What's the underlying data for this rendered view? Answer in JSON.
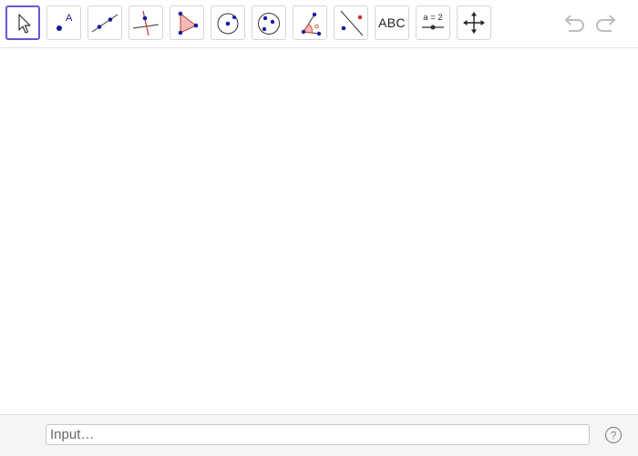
{
  "toolbar": {
    "tools": [
      {
        "id": "move",
        "icon": "move-pointer-icon",
        "selected": true
      },
      {
        "id": "point",
        "icon": "point-icon",
        "label_text": "A"
      },
      {
        "id": "line",
        "icon": "line-through-two-points-icon"
      },
      {
        "id": "perpendicular",
        "icon": "perpendicular-line-icon"
      },
      {
        "id": "polygon",
        "icon": "polygon-icon"
      },
      {
        "id": "circle-center-point",
        "icon": "circle-center-point-icon"
      },
      {
        "id": "circle-three-points",
        "icon": "circle-three-points-icon"
      },
      {
        "id": "angle",
        "icon": "angle-icon"
      },
      {
        "id": "reflect",
        "icon": "reflect-about-line-icon"
      },
      {
        "id": "text",
        "icon": "text-icon",
        "label_text": "ABC"
      },
      {
        "id": "slider",
        "icon": "slider-icon",
        "label_text": "a = 2"
      },
      {
        "id": "move-graphics-view",
        "icon": "move-graphics-view-icon"
      }
    ],
    "undo_icon": "undo-icon",
    "redo_icon": "redo-icon"
  },
  "input_bar": {
    "placeholder": "Input…",
    "help_icon": "help-icon",
    "help_text": "?"
  },
  "colors": {
    "accent_selected": "#6557d2",
    "point_blue": "#1a1aa0",
    "polygon_fill": "#f4b9b9",
    "polygon_stroke": "#c0392b",
    "disabled_gray": "#bdbdbd"
  }
}
